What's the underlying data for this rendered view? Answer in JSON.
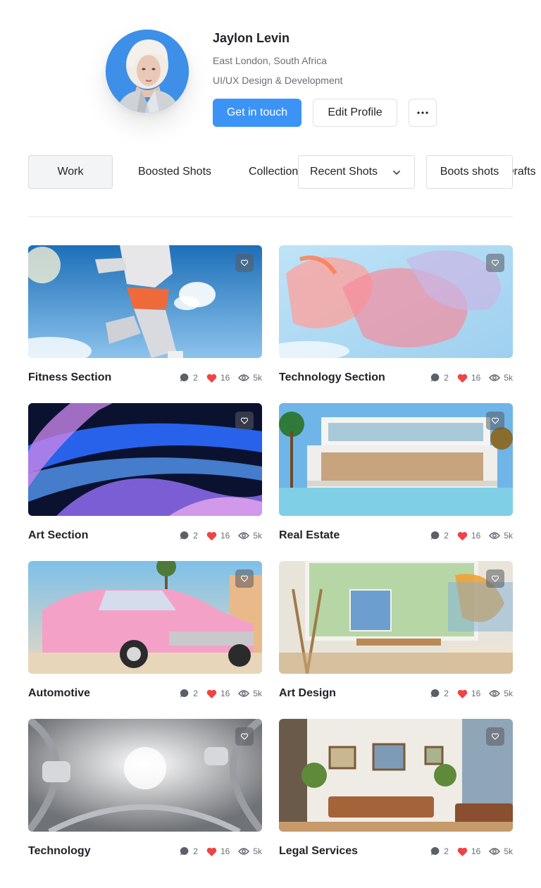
{
  "profile": {
    "name": "Jaylon Levin",
    "location": "East London, South Africa",
    "role": "UI/UX Design & Development",
    "contact_label": "Get in touch",
    "edit_label": "Edit Profile",
    "more_label": "···"
  },
  "tabs": {
    "work": "Work",
    "boosted": "Boosted Shots",
    "collections": "Collections",
    "dropdown": "Recent Shots",
    "boots": "Boots shots",
    "drafts": "Drafts"
  },
  "colors": {
    "accent": "#3c93f6",
    "heart": "#ef4444",
    "avatar_bg": "#3d8fe8"
  },
  "shots": [
    {
      "title": "Fitness Section",
      "comments": "2",
      "likes": "16",
      "views": "5k"
    },
    {
      "title": "Technology Section",
      "comments": "2",
      "likes": "16",
      "views": "5k"
    },
    {
      "title": "Art Section",
      "comments": "2",
      "likes": "16",
      "views": "5k"
    },
    {
      "title": "Real Estate",
      "comments": "2",
      "likes": "16",
      "views": "5k"
    },
    {
      "title": "Automotive",
      "comments": "2",
      "likes": "16",
      "views": "5k"
    },
    {
      "title": "Art Design",
      "comments": "2",
      "likes": "16",
      "views": "5k"
    },
    {
      "title": "Technology",
      "comments": "2",
      "likes": "16",
      "views": "5k"
    },
    {
      "title": "Legal Services",
      "comments": "2",
      "likes": "16",
      "views": "5k"
    }
  ],
  "icons": {
    "comment": "comment-icon",
    "like": "heart-icon",
    "view": "eye-icon",
    "favorite": "heart-outline-icon",
    "dropdown": "chevron-down-icon",
    "more": "more-horizontal-icon"
  }
}
